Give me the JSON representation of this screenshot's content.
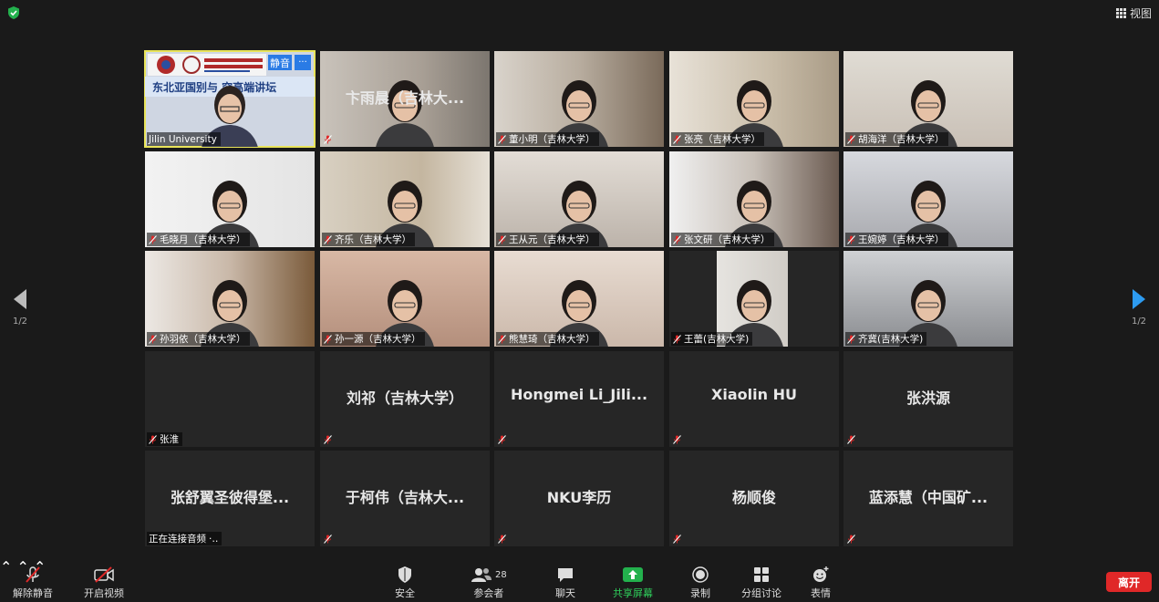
{
  "topbar": {
    "view_label": "视图"
  },
  "pager": {
    "left": "1/2",
    "right": "1/2"
  },
  "host": {
    "label": "Jilin University",
    "banner": "东北亚国别与      究高端讲坛",
    "mute_tag": "静音",
    "more_tag": "···"
  },
  "tiles": [
    {
      "name": "卞雨晨（吉林大...",
      "label": ""
    },
    {
      "name": "",
      "label": "董小明（吉林大学）"
    },
    {
      "name": "",
      "label": "张亮（吉林大学）"
    },
    {
      "name": "",
      "label": "胡海洋（吉林大学）"
    },
    {
      "name": "",
      "label": "毛晓月（吉林大学）"
    },
    {
      "name": "",
      "label": "齐乐（吉林大学）"
    },
    {
      "name": "",
      "label": "王从元（吉林大学）"
    },
    {
      "name": "",
      "label": "张文研（吉林大学）"
    },
    {
      "name": "",
      "label": "王婉婷（吉林大学）"
    },
    {
      "name": "",
      "label": "孙羽依（吉林大学）"
    },
    {
      "name": "",
      "label": "孙一源（吉林大学）"
    },
    {
      "name": "",
      "label": "熊慧琦（吉林大学）"
    },
    {
      "name": "",
      "label": "王蕾(吉林大学)"
    },
    {
      "name": "",
      "label": "齐冀(吉林大学)"
    },
    {
      "name": "",
      "label": "张淮"
    },
    {
      "name": "刘祁（吉林大学）",
      "label": ""
    },
    {
      "name": "Hongmei  Li_Jili...",
      "label": ""
    },
    {
      "name": "Xiaolin HU",
      "label": ""
    },
    {
      "name": "张洪源",
      "label": ""
    },
    {
      "name": "张舒翼圣彼得堡...",
      "label": "正在连接音频"
    },
    {
      "name": "于柯伟（吉林大...",
      "label": ""
    },
    {
      "name": "NKU李历",
      "label": ""
    },
    {
      "name": "杨顺俊",
      "label": ""
    },
    {
      "name": "蓝添慧（中国矿...",
      "label": ""
    }
  ],
  "toolbar": {
    "unmute": "解除静音",
    "start_video": "开启视频",
    "security": "安全",
    "participants": "参会者",
    "participants_count": "28",
    "chat": "聊天",
    "share": "共享屏幕",
    "record": "录制",
    "breakout": "分组讨论",
    "reactions": "表情",
    "leave": "离开"
  },
  "colors": {
    "accent": "#2a7be5",
    "share": "#23b14d",
    "leave": "#e02828",
    "active_speaker": "#e9e45a",
    "mic_off": "#e02828"
  }
}
